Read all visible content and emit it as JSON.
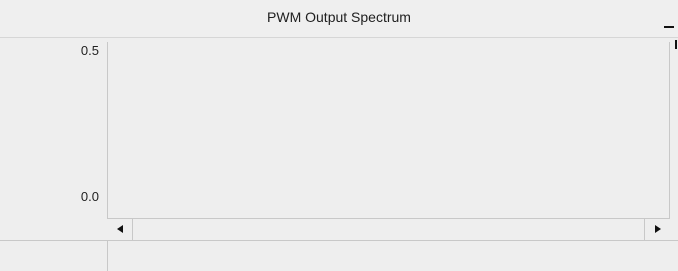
{
  "panel": {
    "title": "PWM Output Spectrum",
    "minimize_icon": "minimize-icon"
  },
  "y_axis": {
    "top_label": "0.5",
    "bottom_label": "0.0"
  },
  "scrollbar": {
    "left_icon": "left-arrow-icon",
    "right_icon": "right-arrow-icon"
  },
  "colors": {
    "background": "#eeeeee",
    "border": "#c8c8c8"
  }
}
